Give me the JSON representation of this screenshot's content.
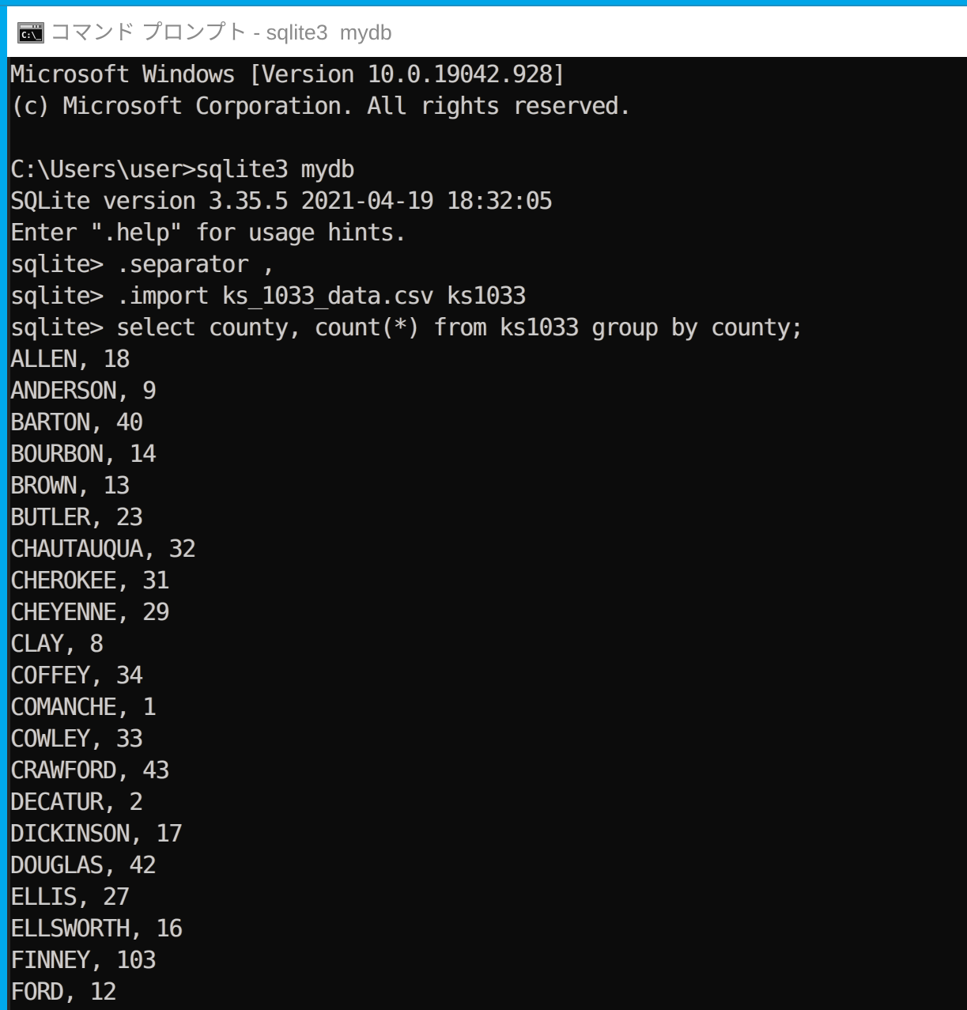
{
  "window": {
    "title": "コマンド プロンプト - sqlite3  mydb",
    "icon": "cmd-console-icon",
    "icon_glyph": "C:\\_",
    "accent_color": "#00A5E8",
    "titlebar_bg": "#FFFFFF",
    "title_color": "#8B8B8B",
    "console_bg": "#0C0C0C",
    "console_fg": "#CCCCCC"
  },
  "console": {
    "lines": [
      "Microsoft Windows [Version 10.0.19042.928]",
      "(c) Microsoft Corporation. All rights reserved.",
      "",
      "C:\\Users\\user>sqlite3 mydb",
      "SQLite version 3.35.5 2021-04-19 18:32:05",
      "Enter \".help\" for usage hints.",
      "sqlite> .separator ,",
      "sqlite> .import ks_1033_data.csv ks1033",
      "sqlite> select county, count(*) from ks1033 group by county;",
      "ALLEN, 18",
      "ANDERSON, 9",
      "BARTON, 40",
      "BOURBON, 14",
      "BROWN, 13",
      "BUTLER, 23",
      "CHAUTAUQUA, 32",
      "CHEROKEE, 31",
      "CHEYENNE, 29",
      "CLAY, 8",
      "COFFEY, 34",
      "COMANCHE, 1",
      "COWLEY, 33",
      "CRAWFORD, 43",
      "DECATUR, 2",
      "DICKINSON, 17",
      "DOUGLAS, 42",
      "ELLIS, 27",
      "ELLSWORTH, 16",
      "FINNEY, 103",
      "FORD, 12"
    ],
    "prompt_history": {
      "shell_prompt": "C:\\Users\\user>",
      "sqlite_prompt": "sqlite>",
      "commands": [
        "sqlite3 mydb",
        ".separator ,",
        ".import ks_1033_data.csv ks1033",
        "select county, count(*) from ks1033 group by county;"
      ]
    },
    "query_result": {
      "columns": [
        "county",
        "count(*)"
      ],
      "rows": [
        [
          "ALLEN",
          18
        ],
        [
          "ANDERSON",
          9
        ],
        [
          "BARTON",
          40
        ],
        [
          "BOURBON",
          14
        ],
        [
          "BROWN",
          13
        ],
        [
          "BUTLER",
          23
        ],
        [
          "CHAUTAUQUA",
          32
        ],
        [
          "CHEROKEE",
          31
        ],
        [
          "CHEYENNE",
          29
        ],
        [
          "CLAY",
          8
        ],
        [
          "COFFEY",
          34
        ],
        [
          "COMANCHE",
          1
        ],
        [
          "COWLEY",
          33
        ],
        [
          "CRAWFORD",
          43
        ],
        [
          "DECATUR",
          2
        ],
        [
          "DICKINSON",
          17
        ],
        [
          "DOUGLAS",
          42
        ],
        [
          "ELLIS",
          27
        ],
        [
          "ELLSWORTH",
          16
        ],
        [
          "FINNEY",
          103
        ],
        [
          "FORD",
          12
        ]
      ]
    }
  }
}
